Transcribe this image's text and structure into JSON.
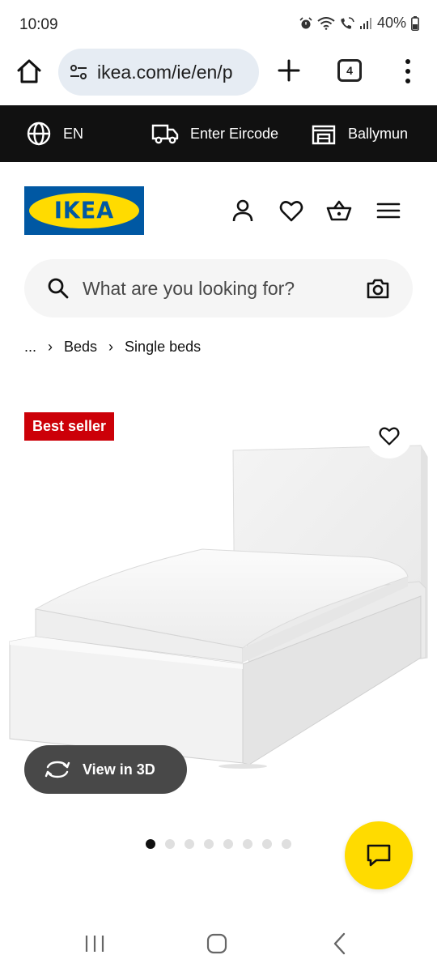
{
  "status_bar": {
    "time": "10:09",
    "battery": "40%",
    "icons": [
      "alarm-icon",
      "wifi-icon",
      "wifi-calling-icon",
      "signal-icon",
      "battery-icon"
    ]
  },
  "browser": {
    "url": "ikea.com/ie/en/p",
    "tab_count": "4",
    "icons": [
      "home-icon",
      "site-settings-icon",
      "new-tab-plus-icon",
      "tab-switcher-icon",
      "more-vert-icon"
    ]
  },
  "service_bar": {
    "language": "EN",
    "eircode": "Enter Eircode",
    "store": "Ballymun"
  },
  "header": {
    "logo_text": "IKEA",
    "icons": [
      "profile-icon",
      "heart-icon",
      "basket-icon",
      "hamburger-menu-icon"
    ]
  },
  "search": {
    "placeholder": "What are you looking for?",
    "value": ""
  },
  "breadcrumb": {
    "ellipsis": "...",
    "items": [
      "Beds",
      "Single beds"
    ],
    "separator": "›"
  },
  "product": {
    "badge": "Best seller",
    "view_3d_label": "View in 3D",
    "image_count": 8,
    "active_image_index": 0
  },
  "colors": {
    "ikea_blue": "#0058a3",
    "ikea_yellow": "#ffdb00",
    "badge_red": "#cc0008",
    "service_bar_bg": "#111111",
    "search_bg": "#f5f5f5",
    "view3d_bg": "#484848"
  }
}
